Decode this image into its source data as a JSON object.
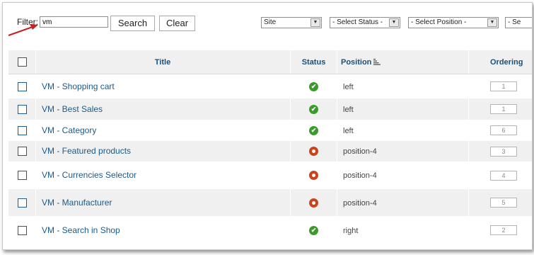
{
  "filter": {
    "label": "Filter:",
    "value": "vm",
    "search_label": "Search",
    "clear_label": "Clear"
  },
  "selects": {
    "site": "Site",
    "status": "- Select Status -",
    "position": "- Select Position -",
    "extra": "- Se"
  },
  "table": {
    "headers": {
      "title": "Title",
      "status": "Status",
      "position": "Position",
      "ordering": "Ordering"
    },
    "rows": [
      {
        "title": "VM - Shopping cart",
        "status": "published",
        "position": "left",
        "ordering": "1"
      },
      {
        "title": "VM - Best Sales",
        "status": "published",
        "position": "left",
        "ordering": "1"
      },
      {
        "title": "VM - Category",
        "status": "published",
        "position": "left",
        "ordering": "6"
      },
      {
        "title": "VM - Featured products",
        "status": "unpublished",
        "position": "position-4",
        "ordering": "3"
      },
      {
        "title": "VM - Currencies Selector",
        "status": "unpublished",
        "position": "position-4",
        "ordering": "4"
      },
      {
        "title": "VM - Manufacturer",
        "status": "unpublished",
        "position": "position-4",
        "ordering": "5"
      },
      {
        "title": "VM - Search in Shop",
        "status": "published",
        "position": "right",
        "ordering": "2"
      }
    ]
  },
  "icons": {
    "published": "check-circle-icon",
    "unpublished": "unpublished-circle-icon",
    "sort": "sort-ascending-icon",
    "annotation": "red-arrow-icon"
  },
  "colors": {
    "link": "#1a5a8a",
    "published": "#3a9a2a",
    "unpublished": "#c9441c",
    "annotation_arrow": "#c62222"
  }
}
